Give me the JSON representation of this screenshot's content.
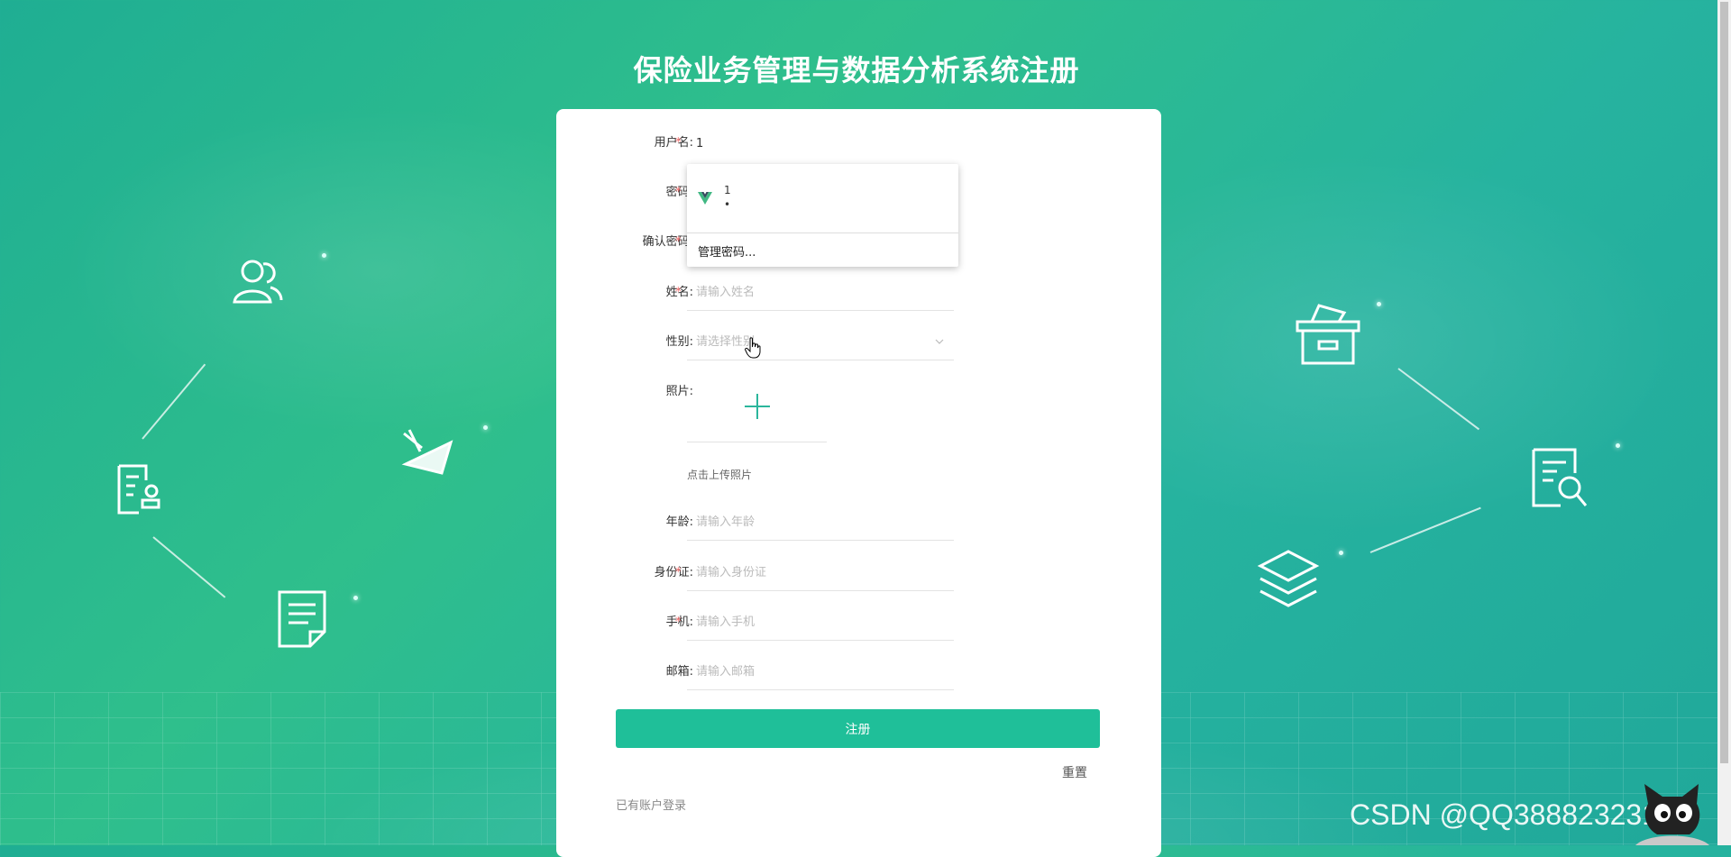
{
  "title": "保险业务管理与数据分析系统注册",
  "form": {
    "username": {
      "label": "用户名:",
      "value": "1",
      "required": true
    },
    "password": {
      "label": "密码:",
      "required": true
    },
    "confirm_password": {
      "label": "确认密码:",
      "required": true
    },
    "name": {
      "label": "姓名:",
      "placeholder": "请输入姓名",
      "required": true
    },
    "gender": {
      "label": "性别:",
      "placeholder": "请选择性别"
    },
    "photo": {
      "label": "照片:",
      "hint": "点击上传照片"
    },
    "age": {
      "label": "年龄:",
      "placeholder": "请输入年龄"
    },
    "id_card": {
      "label": "身份证:",
      "placeholder": "请输入身份证",
      "required": true
    },
    "phone": {
      "label": "手机:",
      "placeholder": "请输入手机",
      "required": true
    },
    "email": {
      "label": "邮箱:",
      "placeholder": "请输入邮箱"
    },
    "required_mark": "*"
  },
  "buttons": {
    "register": "注册",
    "reset": "重置",
    "login": "已有账户登录"
  },
  "autofill": {
    "username": "1",
    "password_mask": "•",
    "manage": "管理密码..."
  },
  "watermark": "CSDN @QQ3888232316",
  "colors": {
    "accent": "#1fbf99",
    "required": "#f56c6c"
  }
}
